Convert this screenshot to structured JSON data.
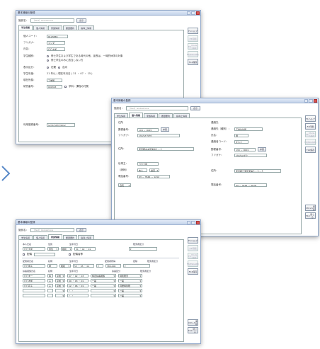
{
  "app_title": "基本情報の登録",
  "facility_label": "施設名：",
  "facility_placeholder": "（Test）Globalmore",
  "facility_button": "表示",
  "tabs": [
    "学生情報",
    "個人情報",
    "家族情報",
    "履歴要約",
    "指導上情報"
  ],
  "side_buttons": [
    {
      "l1": "F1",
      "l2": "ヘルプ"
    },
    {
      "l1": "F3",
      "l2": "印刷"
    },
    {
      "l1": "F5",
      "l2": "Mode Upd"
    },
    {
      "l1": "F7",
      "l2": "(ESCAPE)"
    },
    {
      "l1": "F12",
      "l2": "保存"
    }
  ],
  "side_bottom": [
    {
      "l1": "Ctrl+S",
      "l2": "保存"
    },
    {
      "l1": "F10",
      "l2": "閉じる"
    }
  ],
  "win1": {
    "labels": [
      "個人コード：",
      "フリガナ：",
      "氏名：",
      "学生種別：",
      "",
      "表示区分：",
      "学生年度：",
      "現在所属：",
      "研究番号：",
      "",
      "利用登録番号："
    ],
    "code_value": "0123456",
    "kana_value": "ヨシダ",
    "name_value": "〇〇大郎",
    "radio1": "修士学生および学生である時代の他、延長は、一時的休学の対象",
    "radio2": "修士学生のみに該当しない方",
    "display_opt1": "在籍",
    "display_opt2": "出向",
    "year_value": "21 年以 ( 現在年月日 ) 31 ・ 07 ・ 15 )",
    "dept_value": "工学部",
    "research_value": "000323",
    "research_check": "学科・課程の付属",
    "bottom_label": "利用日 同 自宅",
    "bottom_btn": "検索",
    "bottom_sel": "住所",
    "reg_value": "1234 5678 9012"
  },
  "win2": {
    "left_title": "住所",
    "right_title": "連絡先",
    "left_labels": [
      "郵便番号：",
      "フリガナ：",
      "住所：",
      "",
      "世帯主：",
      "（続柄）",
      "電話番号："
    ],
    "right_labels": [
      "連絡先（種別）：",
      "氏名：",
      "連絡者コード：",
      "郵便番号：",
      "フリガナ：",
      "",
      "住所：",
      "",
      "電話番号："
    ],
    "zip_l": "104 － 0045",
    "zip_btn": "参照",
    "kana_l": "ﾄｳｷｮｳﾄﾁｭｳｵｳｸ",
    "addr_l": "東京都中央区築地１－１",
    "head_name": "〇〇大郎",
    "relation": "本人",
    "relation_sel": "世帯",
    "tel_l": "03 － 3544 － 1212",
    "bottom_sel": "自宅",
    "contact_type": "下宿先住所",
    "contact_name": "母",
    "contact_code": "まるさ",
    "zip_r": "130 － 0001",
    "kana_r": "ﾄｳｷｮｳﾄｽﾐﾀﾞｸ",
    "addr_r": "東京都江東区東陽３－２－３",
    "tel_r": "03 － 3234 － 5678"
  },
  "win3": {
    "top_headers": [
      "本人氏名",
      "性別",
      "生年月日",
      "",
      "障害者区分"
    ],
    "self_name": "〇〇大郎",
    "self_sex": "男性",
    "self_era": "昭和",
    "self_dob": "51 ・ 02 ・ 01",
    "spouse_label": "配偶",
    "spouse_check": "配偶者等",
    "mid_headers": [
      "配偶者氏名",
      "続柄",
      "生年月日",
      "配偶者所得",
      "控除",
      "障害者区分"
    ],
    "spouse_name": "〇〇康子",
    "spouse_rel": "妻",
    "spouse_era": "昭和",
    "spouse_dob": "53 ・ 05 ・ 01",
    "spouse_income": "380,000",
    "dep_headers": [
      "扶養親族氏名",
      "続柄",
      "生年月日",
      "扶養区分",
      "障害者区分"
    ],
    "dependents": [
      {
        "name": "〇〇太一",
        "rel": "長",
        "era": "平成",
        "dob": "07 ・ 02 ・ 03",
        "type": "特定扶養親族"
      },
      {
        "name": "〇〇次郎",
        "rel": "子",
        "era": "平成",
        "dob": "09 ・ 03 ・ 01",
        "type": "一般"
      },
      {
        "name": "〇〇花子",
        "rel": "子",
        "era": "平成",
        "dob": "12 ・ 06 ・ 01",
        "type": "一般"
      },
      {
        "name": "",
        "rel": "",
        "era": "",
        "dob": "・ ・",
        "type": ""
      },
      {
        "name": "",
        "rel": "",
        "era": "",
        "dob": "・ ・",
        "type": ""
      }
    ],
    "dep_extra": [
      "特別障害",
      "一般",
      "同居特別障",
      "一般",
      "一般"
    ]
  }
}
